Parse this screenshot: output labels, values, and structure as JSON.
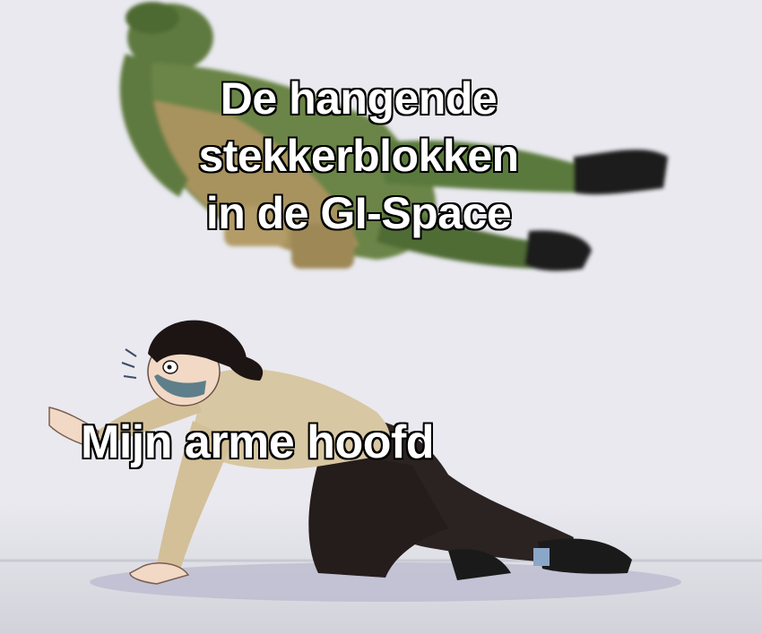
{
  "meme": {
    "top_caption_lines": [
      "De hangende",
      "stekkerblokken",
      "in de GI-Space"
    ],
    "bottom_caption": "Mijn arme hoofd"
  },
  "colors": {
    "background": "#e9e9ef",
    "floor": "#d6d6de",
    "floor_shadow": "#b9b9cf",
    "soldier_green": "#5e7a3f",
    "soldier_tan": "#a8935f",
    "boots": "#1e1e1e",
    "jacket": "#d8c7a3",
    "pants": "#2b2222",
    "hair": "#1d1414",
    "skin": "#f1d9c5",
    "mask": "#5e7f8a"
  }
}
